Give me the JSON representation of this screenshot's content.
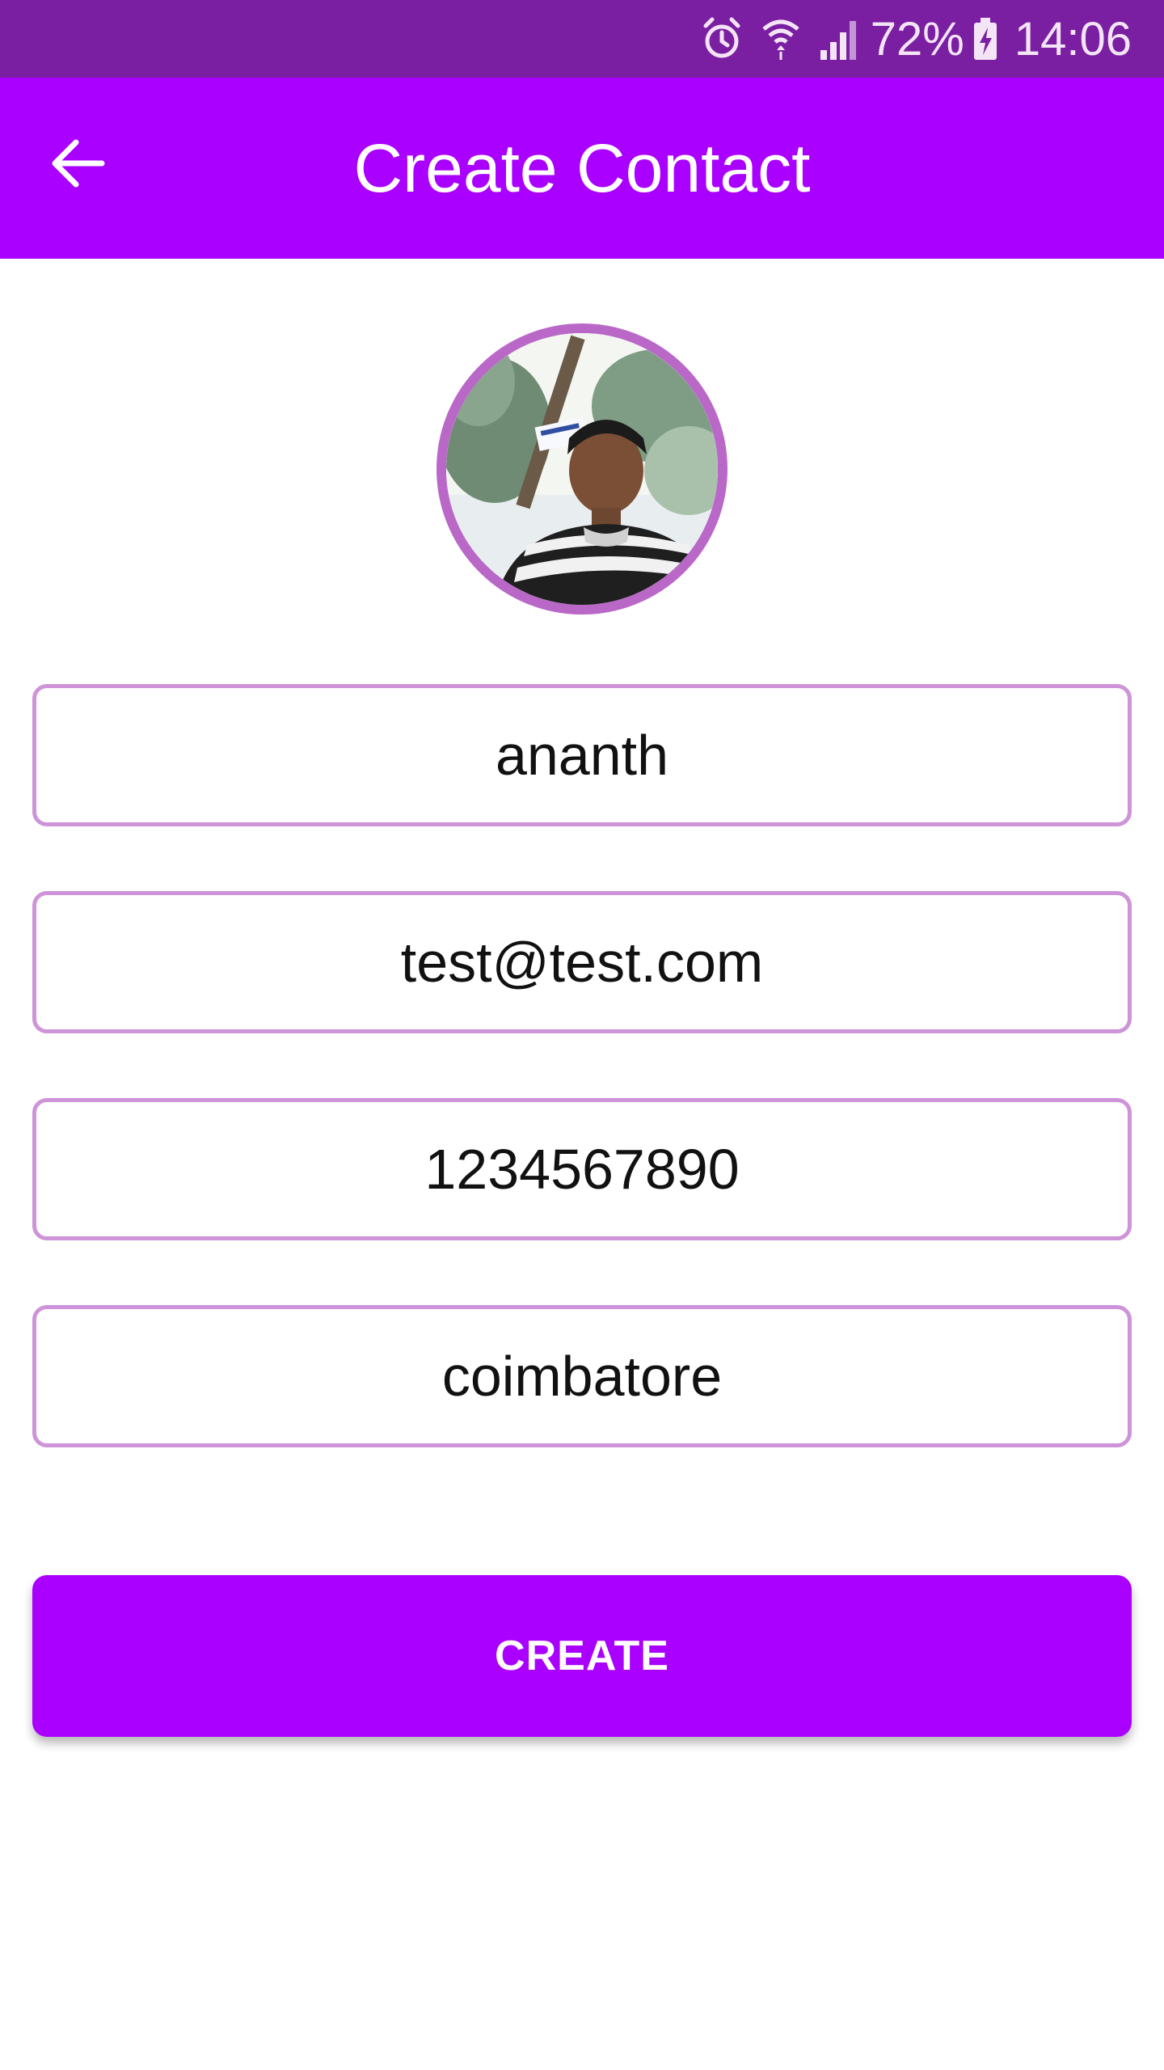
{
  "status_bar": {
    "battery": "72%",
    "time": "14:06",
    "icons": [
      "alarm-icon",
      "wifi-icon",
      "signal-icon",
      "battery-charging-icon"
    ]
  },
  "app_bar": {
    "title": "Create Contact",
    "back_icon": "arrow-back-icon"
  },
  "avatar": {
    "icon": "profile-photo"
  },
  "form": {
    "name": "ananth",
    "email": "test@test.com",
    "phone": "1234567890",
    "city": "coimbatore"
  },
  "actions": {
    "create_label": "CREATE"
  },
  "colors": {
    "status_bar": "#7b1fa2",
    "primary": "#aa00ff",
    "field_border": "#ce93d8",
    "avatar_border": "#ba68c8"
  }
}
